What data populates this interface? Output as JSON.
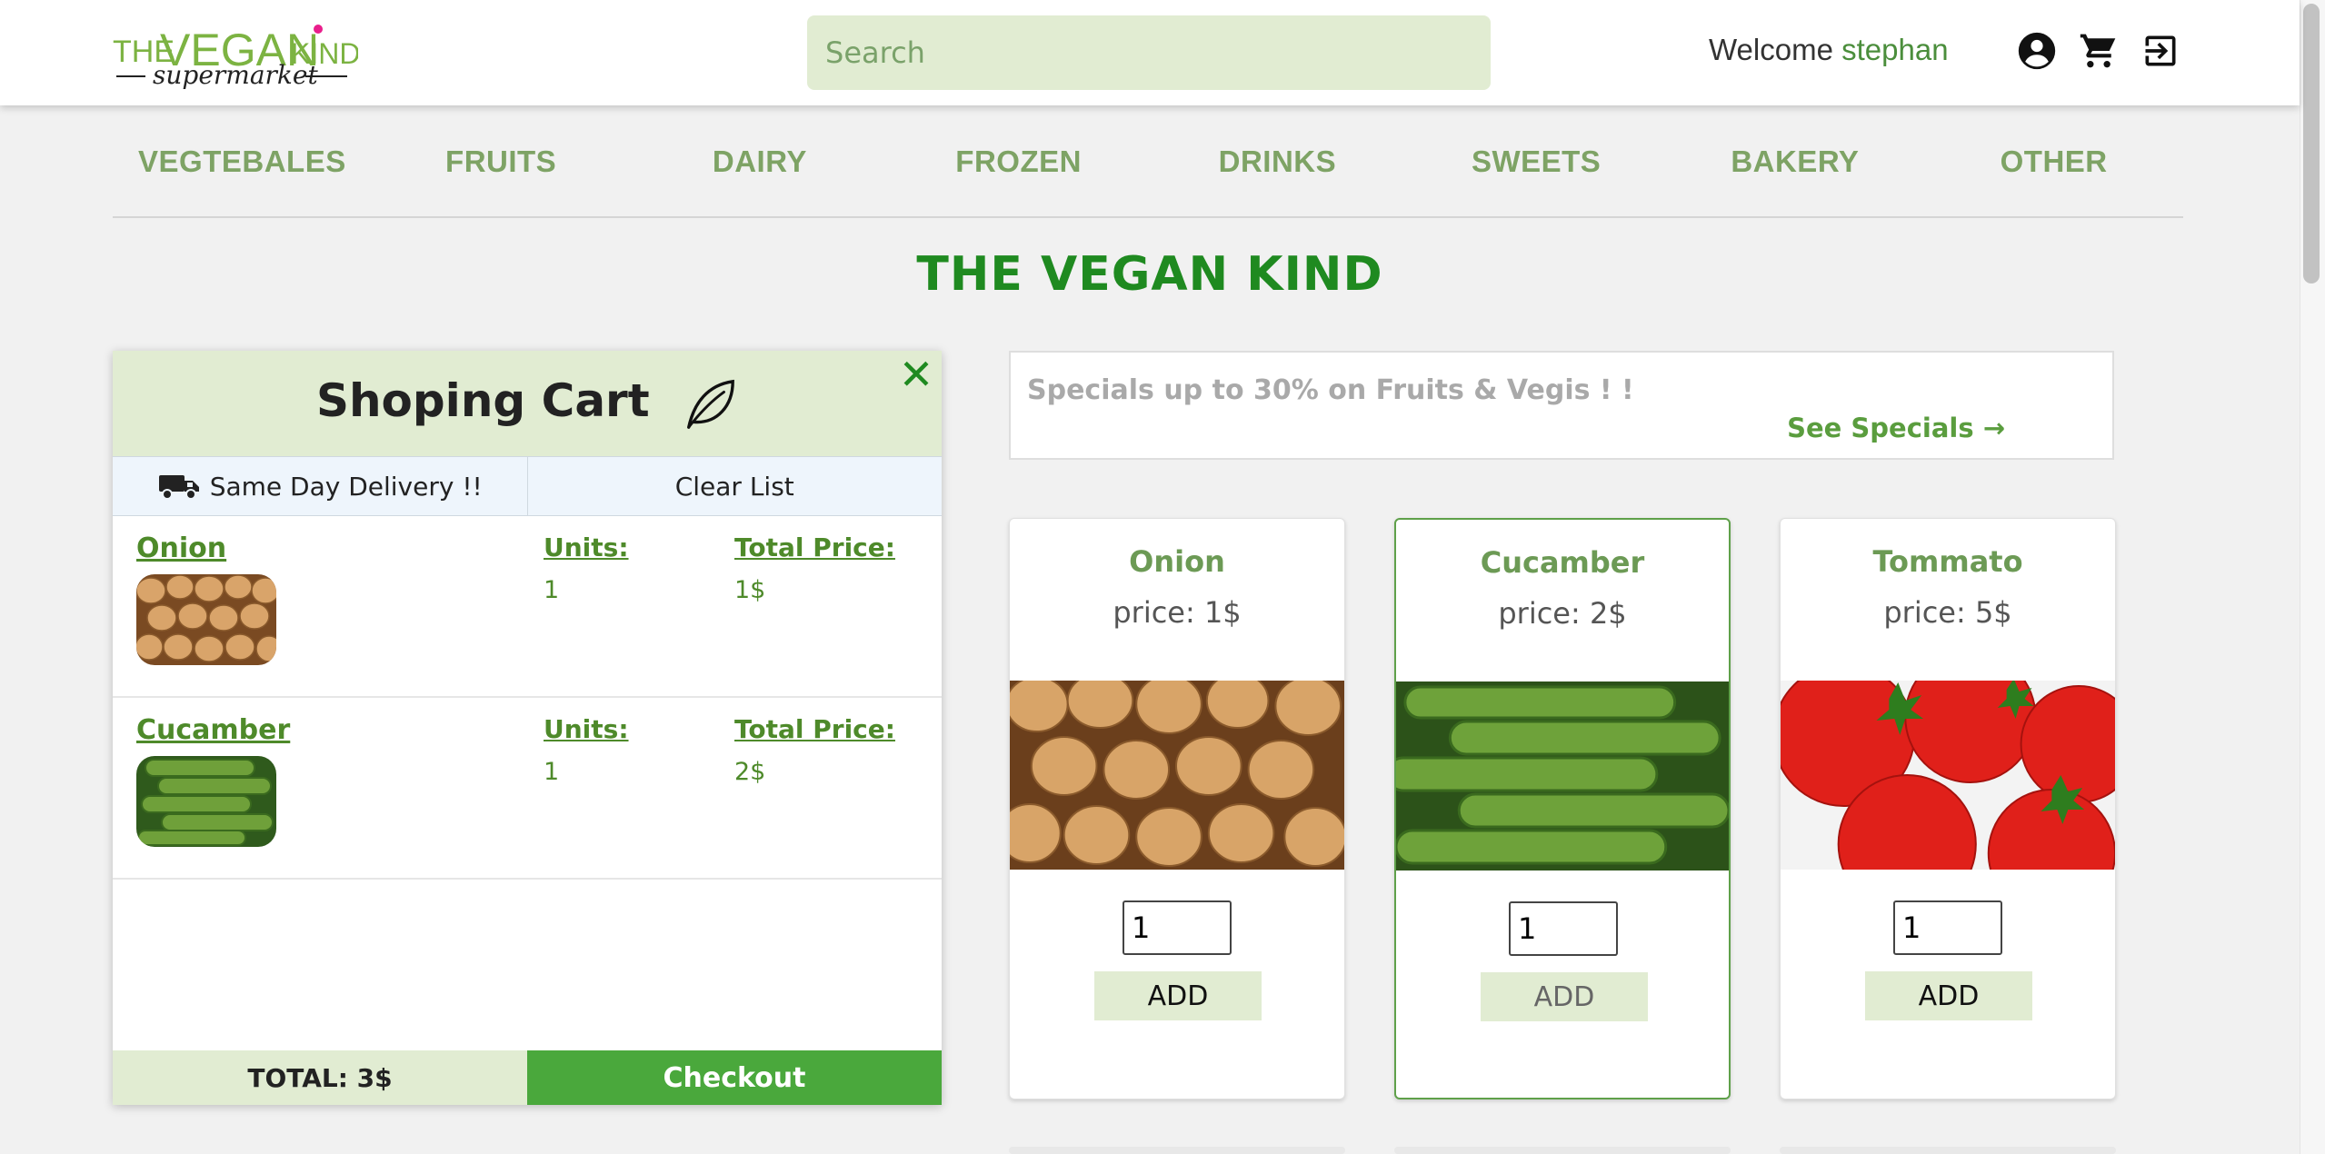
{
  "header": {
    "logo_text": "THE VEGAN KIND supermarket",
    "search_placeholder": "Search",
    "welcome_label": "Welcome",
    "username": "stephan",
    "icons": [
      "account-circle-icon",
      "shopping-cart-icon",
      "logout-icon"
    ]
  },
  "nav": {
    "items": [
      {
        "label": "VEGTEBALES"
      },
      {
        "label": "FRUITS"
      },
      {
        "label": "DAIRY"
      },
      {
        "label": "FROZEN"
      },
      {
        "label": "DRINKS"
      },
      {
        "label": "SWEETS"
      },
      {
        "label": "BAKERY"
      },
      {
        "label": "OTHER"
      }
    ]
  },
  "main": {
    "title": "THE VEGAN KIND"
  },
  "cart": {
    "title": "Shoping Cart",
    "close_label": "✕",
    "delivery_label": "Same Day Delivery !!",
    "clear_label": "Clear List",
    "units_label": "Units:",
    "total_price_label": "Total Price:",
    "items": [
      {
        "name": "Onion",
        "units": "1",
        "total": "1$",
        "image": "onion"
      },
      {
        "name": "Cucamber",
        "units": "1",
        "total": "2$",
        "image": "cucumber"
      }
    ],
    "total_label": "TOTAL: 3$",
    "checkout_label": "Checkout"
  },
  "specials": {
    "text": "Specials up to 30% on Fruits & Vegis ! !",
    "link_label": "See Specials →"
  },
  "products": [
    {
      "name": "Onion",
      "price": "price: 1$",
      "qty": "1",
      "add_label": "ADD",
      "image": "onion"
    },
    {
      "name": "Cucamber",
      "price": "price: 2$",
      "qty": "1",
      "add_label": "ADD",
      "image": "cucumber",
      "selected": true
    },
    {
      "name": "Tommato",
      "price": "price: 5$",
      "qty": "1",
      "add_label": "ADD",
      "image": "tomato"
    }
  ],
  "colors": {
    "brand_green": "#1f8a20",
    "accent_green": "#4aa83c",
    "light_green": "#e1ecd2",
    "nav_green": "#7ea365"
  }
}
